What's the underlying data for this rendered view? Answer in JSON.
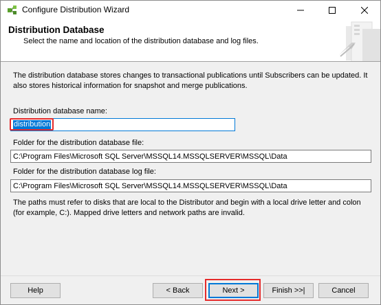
{
  "window": {
    "title": "Configure Distribution Wizard",
    "icon": "sql-wizard-icon"
  },
  "header": {
    "title": "Distribution Database",
    "subtitle": "Select the name and location of the distribution database and log files."
  },
  "intro": "The distribution database stores changes to transactional publications until Subscribers can be updated. It also stores historical information for snapshot and merge publications.",
  "fields": {
    "db_name_label": "Distribution database name:",
    "db_name_value": "distribution",
    "data_folder_label": "Folder for the distribution database file:",
    "data_folder_value": "C:\\Program Files\\Microsoft SQL Server\\MSSQL14.MSSQLSERVER\\MSSQL\\Data",
    "log_folder_label": "Folder for the distribution database log file:",
    "log_folder_value": "C:\\Program Files\\Microsoft SQL Server\\MSSQL14.MSSQLSERVER\\MSSQL\\Data"
  },
  "note": "The paths must refer to disks that are local to the Distributor and begin with a local drive letter and colon (for example, C:). Mapped drive letters and network paths are invalid.",
  "buttons": {
    "help": "Help",
    "back": "< Back",
    "next": "Next >",
    "finish": "Finish >>|",
    "cancel": "Cancel"
  },
  "colors": {
    "highlight": "#e52a2a",
    "selection": "#0078d7"
  }
}
